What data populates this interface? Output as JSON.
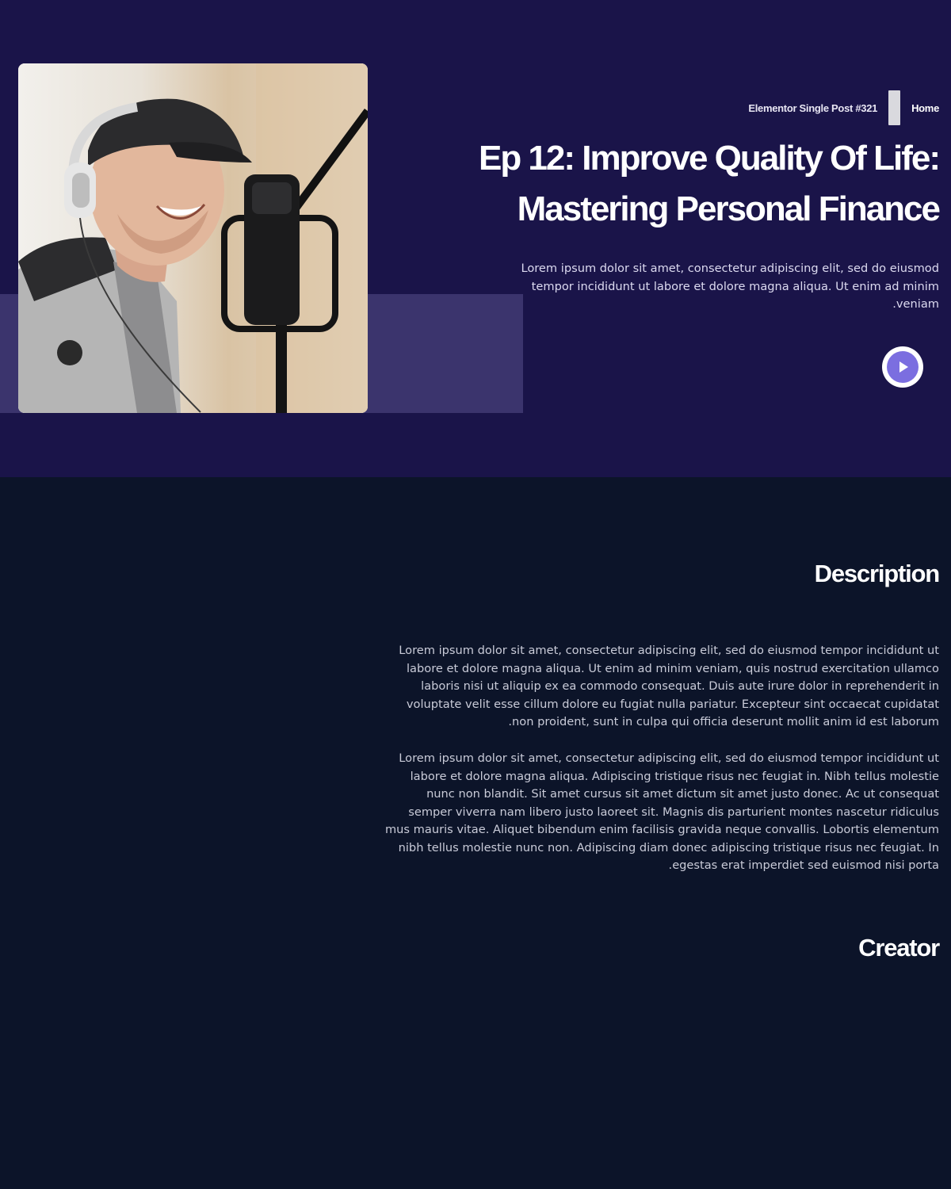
{
  "hero": {
    "image_alt": "man-with-headphones-podcast-photo",
    "breadcrumb": {
      "current": "Elementor Single Post #321",
      "home": "Home"
    },
    "title": "Ep 12: Improve Quality Of Life: Mastering Personal Finance",
    "intro": "Lorem ipsum dolor sit amet, consectetur adipiscing elit, sed do eiusmod tempor incididunt ut labore et dolore magna aliqua. Ut enim ad minim veniam.",
    "play_icon": "play-icon"
  },
  "description": {
    "heading": "Description",
    "paragraphs": [
      "Lorem ipsum dolor sit amet, consectetur adipiscing elit, sed do eiusmod tempor incididunt ut labore et dolore magna aliqua. Ut enim ad minim veniam, quis nostrud exercitation ullamco laboris nisi ut aliquip ex ea commodo consequat. Duis aute irure dolor in reprehenderit in voluptate velit esse cillum dolore eu fugiat nulla pariatur. Excepteur sint occaecat cupidatat non proident, sunt in culpa qui officia deserunt mollit anim id est laborum.",
      "Lorem ipsum dolor sit amet, consectetur adipiscing elit, sed do eiusmod tempor incididunt ut labore et dolore magna aliqua. Adipiscing tristique risus nec feugiat in. Nibh tellus molestie nunc non blandit. Sit amet cursus sit amet dictum sit amet justo donec. Ac ut consequat semper viverra nam libero justo laoreet sit. Magnis dis parturient montes nascetur ridiculus mus mauris vitae. Aliquet bibendum enim facilisis gravida neque convallis. Lobortis elementum nibh tellus molestie nunc non. Adipiscing diam donec adipiscing tristique risus nec feugiat. In egestas erat imperdiet sed euismod nisi porta."
    ]
  },
  "creator": {
    "heading": "Creator"
  },
  "colors": {
    "hero_bg": "#1a1449",
    "page_bg": "#0c1429",
    "accent": "#7b6ee0"
  }
}
